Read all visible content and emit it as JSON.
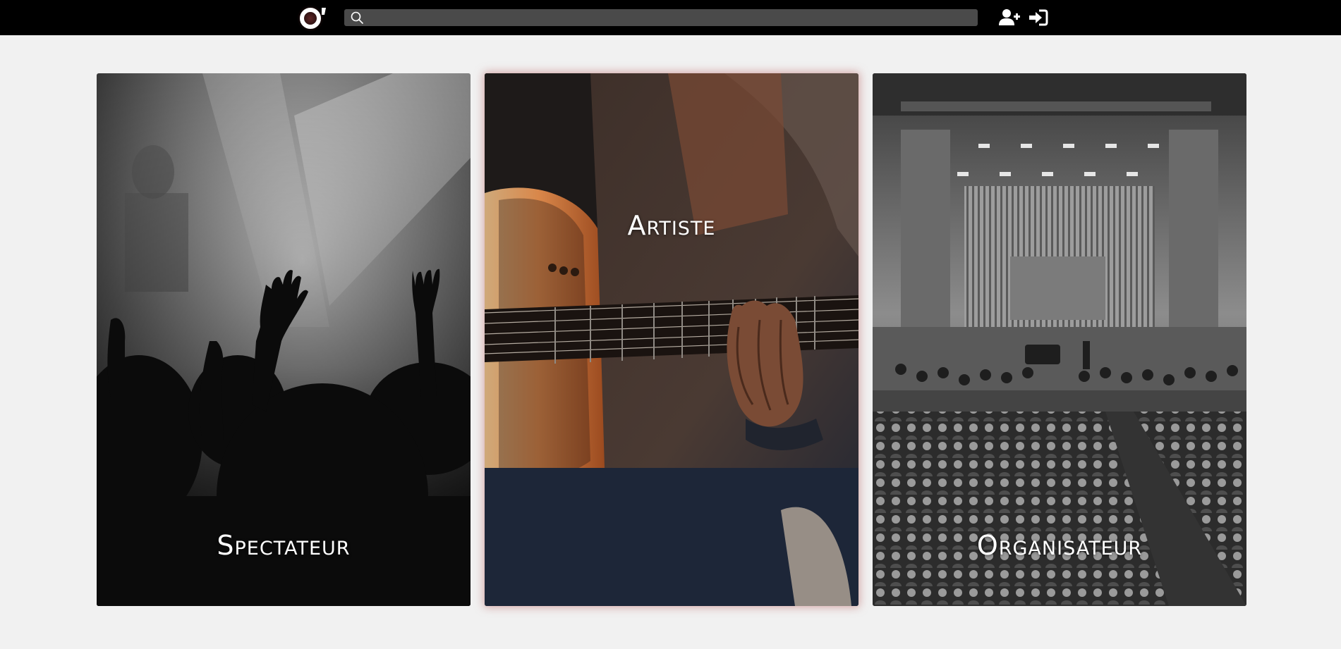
{
  "header": {
    "logo_text": "O'",
    "search_placeholder": "",
    "search_value": "",
    "icons": {
      "logo": "brand-logo",
      "search": "search-icon",
      "register": "user-plus-icon",
      "login": "sign-in-icon"
    }
  },
  "cards": [
    {
      "label": "Spectateur",
      "image": "concert-crowd-hands-raised-grayscale"
    },
    {
      "label": "Artiste",
      "image": "guitarist-playing-acoustic-guitar-color"
    },
    {
      "label": "Organisateur",
      "image": "orchestra-concert-hall-grayscale"
    }
  ],
  "colors": {
    "topbar_bg": "#000000",
    "page_bg": "#f1f1f1",
    "search_bg": "#4a4a4a",
    "highlight_glow": "#be6e6e",
    "label_text": "#ffffff"
  }
}
